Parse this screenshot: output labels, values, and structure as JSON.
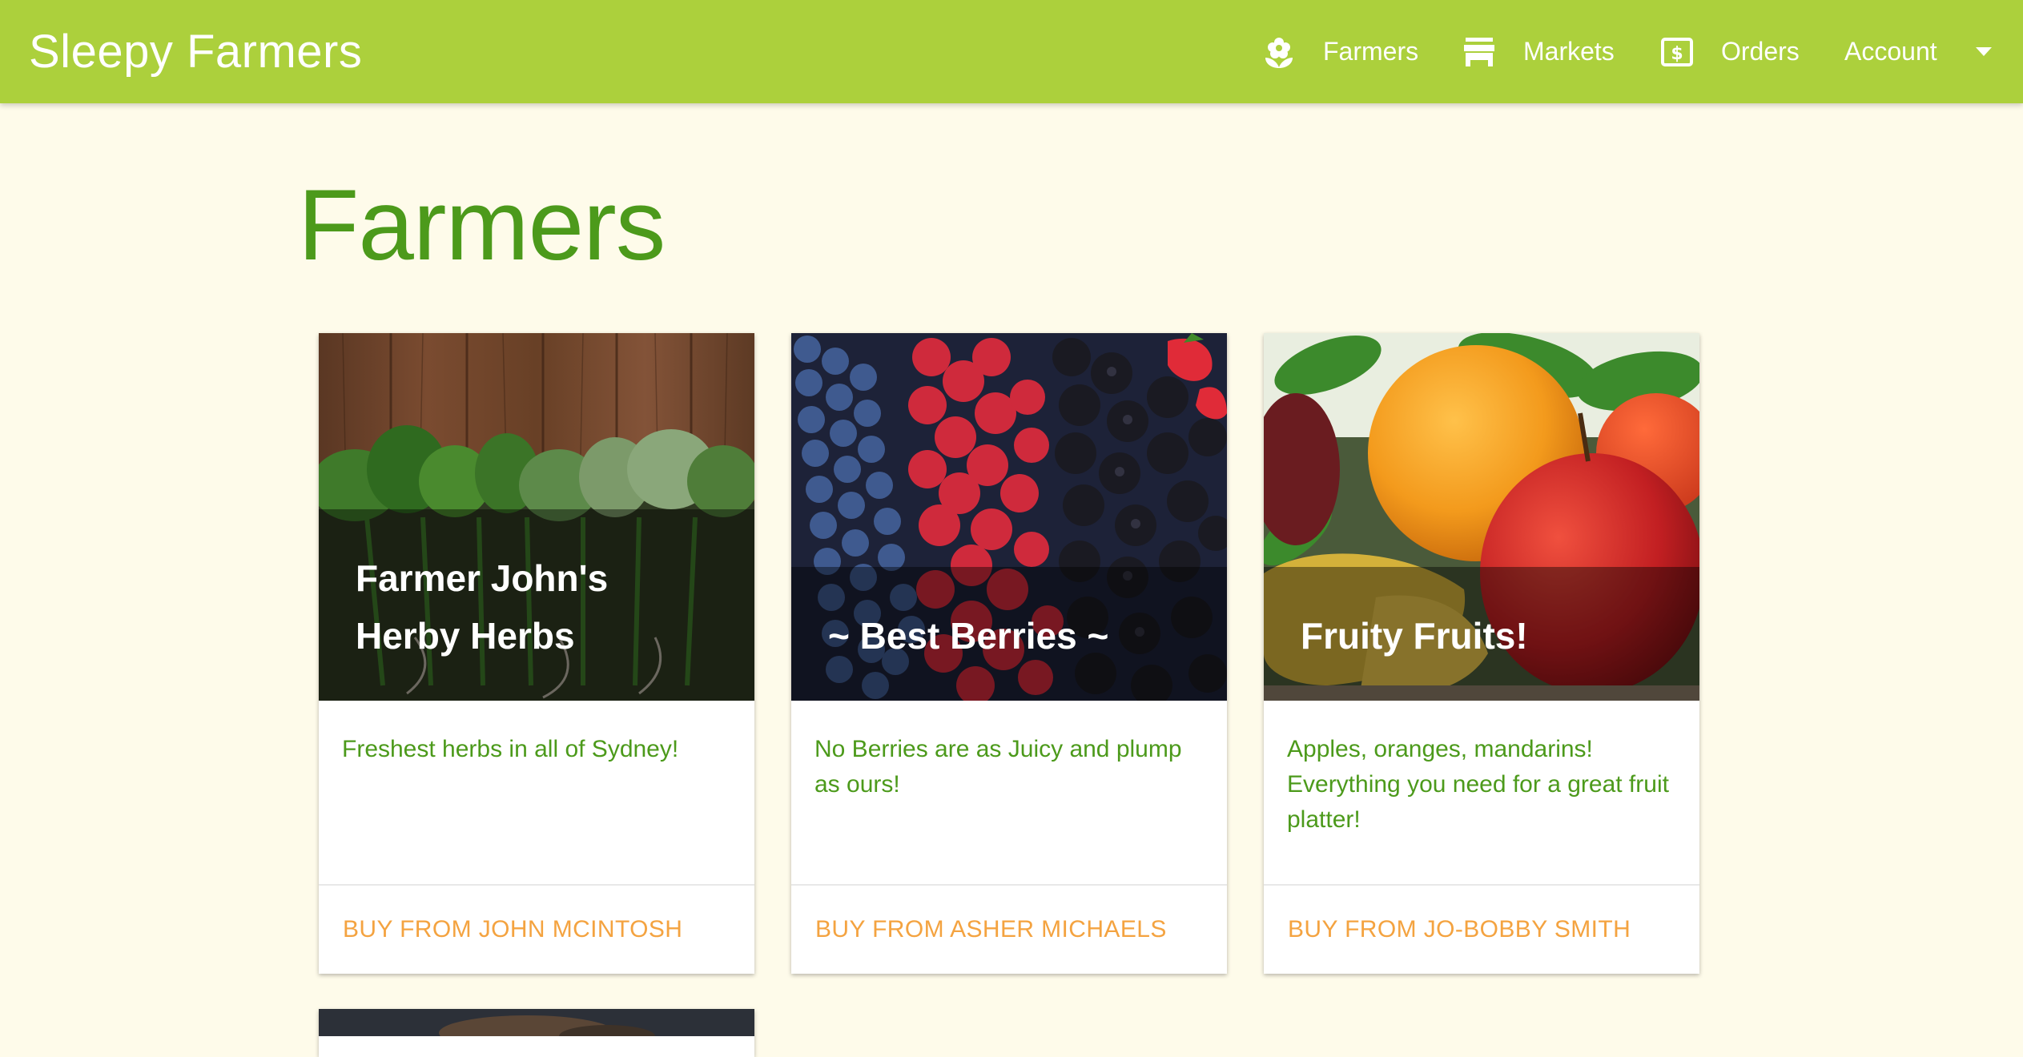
{
  "app": {
    "brand": "Sleepy Farmers"
  },
  "nav": {
    "farmers": "Farmers",
    "markets": "Markets",
    "orders": "Orders",
    "account": "Account"
  },
  "page": {
    "title": "Farmers"
  },
  "cards": [
    {
      "title": "Farmer John's Herby Herbs",
      "description": "Freshest herbs in all of Sydney!",
      "action": "BUY FROM JOHN MCINTOSH",
      "image": "herbs-on-wood"
    },
    {
      "title": "~ Best Berries ~",
      "description": "No Berries are as Juicy and plump as ours!",
      "action": "BUY FROM ASHER MICHAELS",
      "image": "mixed-berries"
    },
    {
      "title": "Fruity Fruits!",
      "description": "Apples, oranges, mandarins! Everything you need for a great fruit platter!",
      "action": "BUY FROM JO-BOBBY SMITH",
      "image": "orange-and-apples"
    }
  ],
  "icons": {
    "farmers": "flower-icon",
    "markets": "storefront-icon",
    "orders": "dollar-bill-icon",
    "account": "caret-down-icon"
  },
  "colors": {
    "navbar": "#acd03c",
    "background": "#fefbea",
    "title_green": "#4c9a1b",
    "action_orange": "#f4a340"
  }
}
